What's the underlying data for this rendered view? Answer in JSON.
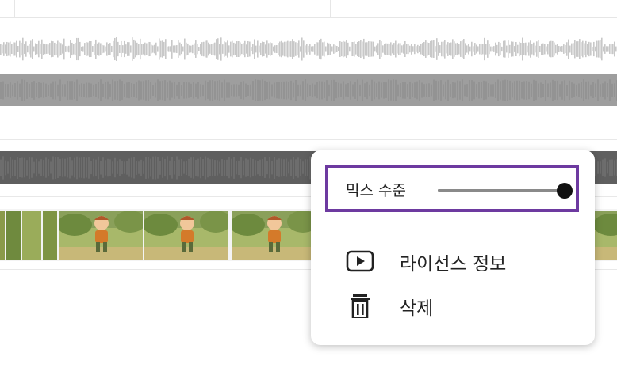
{
  "context_menu": {
    "mix_level": {
      "label": "믹스 수준",
      "value": 1.0
    },
    "items": [
      {
        "label": "라이선스 정보",
        "icon": "play-box-icon"
      },
      {
        "label": "삭제",
        "icon": "trash-icon"
      }
    ],
    "focus_color": "#6d3aa0"
  },
  "timeline": {
    "audio_tracks": [
      {
        "kind": "music-waveform",
        "color": "#c8c8c8"
      },
      {
        "kind": "voice-band",
        "color": "#9e9e9e"
      },
      {
        "kind": "narration-band",
        "color": "#5f5f5f"
      }
    ],
    "video_track": {
      "kind": "thumbnail-strip",
      "thumbnail": "cartoon-boy-walking-forest"
    }
  }
}
